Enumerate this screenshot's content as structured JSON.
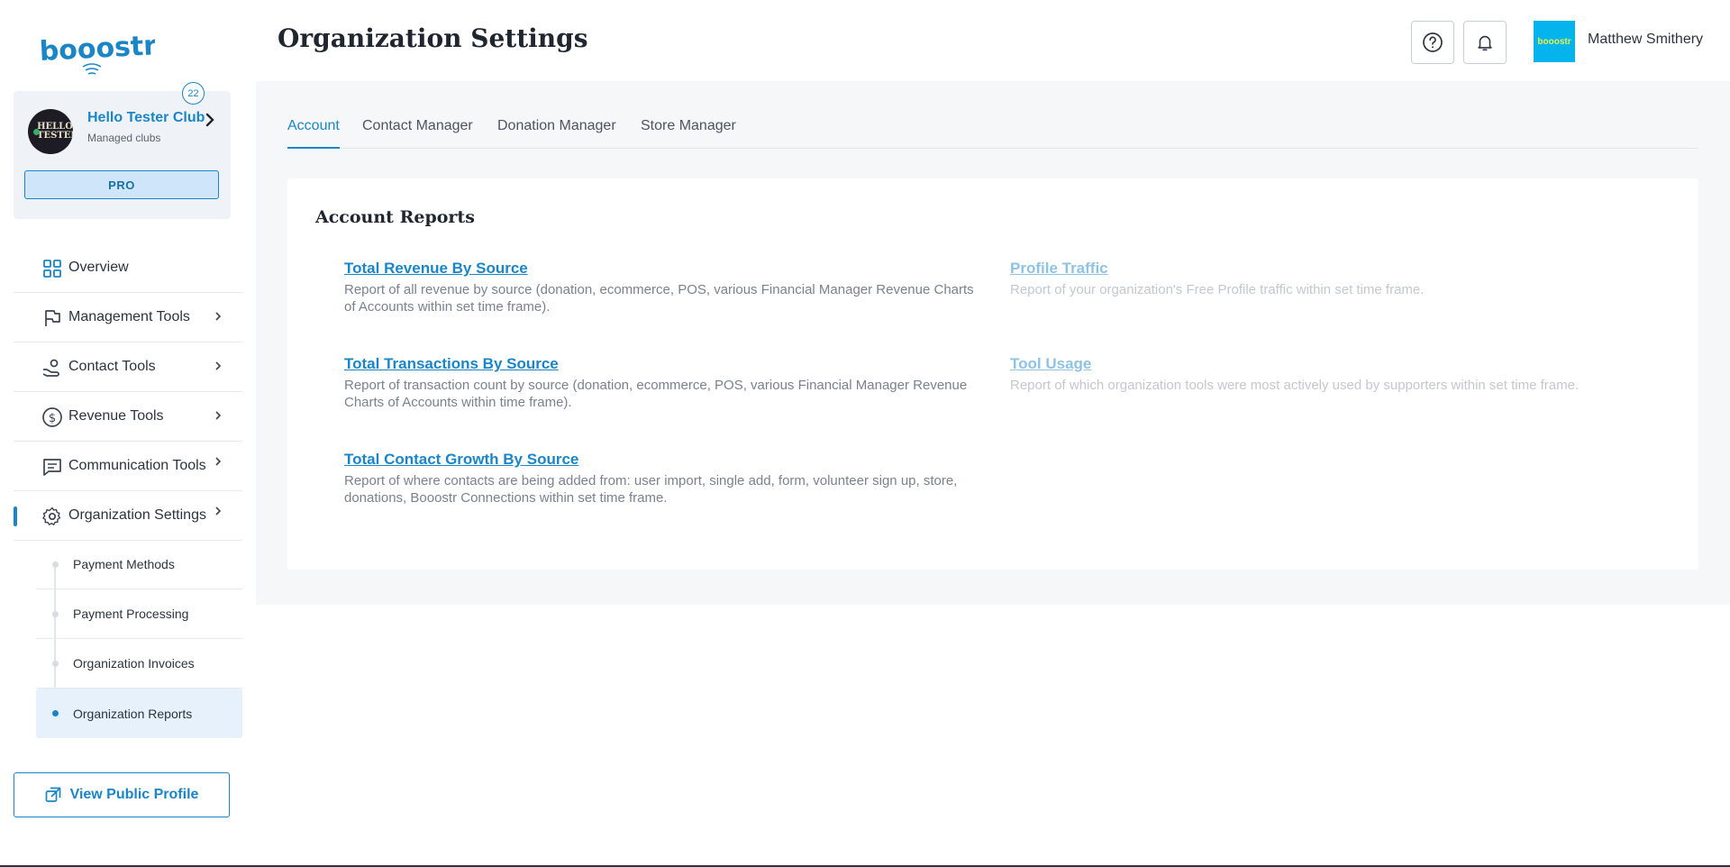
{
  "brand": {
    "logo_text": "booostr"
  },
  "club": {
    "name": "Hello Tester Club",
    "subtitle": "Managed clubs",
    "badge_count": "22",
    "plan": "PRO",
    "avatar_text": "HELLO TESTER"
  },
  "sidebar": {
    "items": [
      {
        "label": "Overview",
        "icon": "grid-icon"
      },
      {
        "label": "Management Tools",
        "icon": "flag-icon"
      },
      {
        "label": "Contact Tools",
        "icon": "hand-person-icon"
      },
      {
        "label": "Revenue Tools",
        "icon": "dollar-circle-icon"
      },
      {
        "label": "Communication Tools",
        "icon": "message-icon"
      },
      {
        "label": "Organization Settings",
        "icon": "gear-icon"
      }
    ],
    "subitems": [
      {
        "label": "Payment Methods"
      },
      {
        "label": "Payment Processing"
      },
      {
        "label": "Organization Invoices"
      },
      {
        "label": "Organization Reports"
      }
    ],
    "view_profile_label": "View Public Profile"
  },
  "header": {
    "title": "Organization Settings",
    "user_name": "Matthew Smithery",
    "user_avatar_text": "booostr"
  },
  "tabs": [
    {
      "label": "Account"
    },
    {
      "label": "Contact Manager"
    },
    {
      "label": "Donation Manager"
    },
    {
      "label": "Store Manager"
    }
  ],
  "reports": {
    "title": "Account Reports",
    "items": [
      {
        "title": "Total Revenue By Source",
        "desc": "Report of all revenue by source (donation, ecommerce, POS, various Financial Manager Revenue Charts of Accounts within set time frame).",
        "enabled": true
      },
      {
        "title": "Profile Traffic",
        "desc": "Report of your organization's Free Profile traffic within set time frame.",
        "enabled": false
      },
      {
        "title": "Total Transactions By Source",
        "desc": "Report of transaction count by source (donation, ecommerce, POS, various Financial Manager Revenue Charts of Accounts within time frame).",
        "enabled": true
      },
      {
        "title": "Tool Usage",
        "desc": "Report of which organization tools were most actively used by supporters within set time frame.",
        "enabled": false
      },
      {
        "title": "Total Contact Growth By Source",
        "desc": "Report of where contacts are being added from: user import, single add, form, volunteer sign up, store, donations, Booostr Connections within set time frame.",
        "enabled": true
      }
    ]
  },
  "colors": {
    "accent": "#1a86c7",
    "pro_bg": "#cfe6fa",
    "main_bg": "#f6f7f8",
    "avatar_bg": "#05b4ec"
  }
}
